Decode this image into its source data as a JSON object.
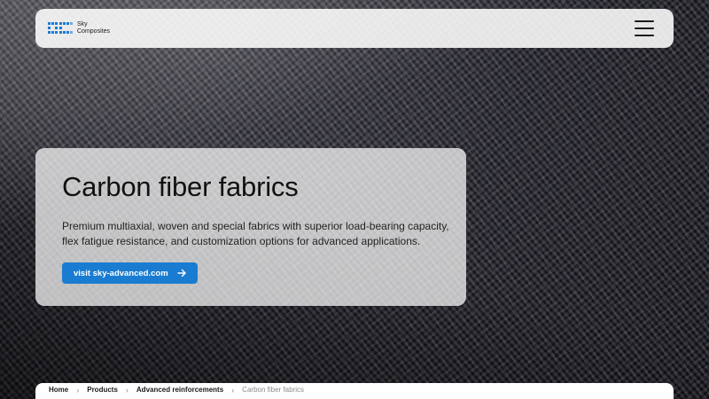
{
  "header": {
    "logo_line1": "Sky",
    "logo_line2": "Composites",
    "menu_icon": "hamburger-menu-icon"
  },
  "hero": {
    "title": "Carbon fiber fabrics",
    "description": "Premium multiaxial, woven and special fabrics with superior load-bearing capacity, flex fatigue resistance, and customization options for advanced applications.",
    "cta_label": "visit sky-advanced.com",
    "cta_icon": "arrow-right-icon"
  },
  "breadcrumb": {
    "items": [
      "Home",
      "Products",
      "Advanced reinforcements"
    ],
    "current": "Carbon fiber fabrics",
    "separator_icon": "chevron-right-icon"
  },
  "colors": {
    "accent": "#1a7cd1",
    "logo_blue": "#1a7cd1"
  }
}
